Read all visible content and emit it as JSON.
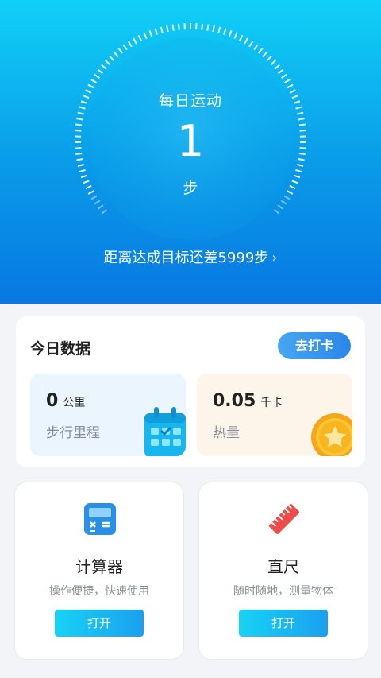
{
  "hero": {
    "title": "每日运动",
    "steps": "1",
    "unit": "步",
    "goal_text": "距离达成目标还差5999步"
  },
  "today": {
    "title": "今日数据",
    "checkin_label": "去打卡",
    "distance": {
      "value": "0",
      "unit": "公里",
      "label": "步行里程"
    },
    "calories": {
      "value": "0.05",
      "unit": "千卡",
      "label": "热量"
    }
  },
  "tools": [
    {
      "name": "计算器",
      "desc": "操作便捷，快速使用",
      "button": "打开",
      "icon": "calculator-icon"
    },
    {
      "name": "直尺",
      "desc": "随时随地，测量物体",
      "button": "打开",
      "icon": "ruler-icon"
    }
  ],
  "colors": {
    "hero_top": "#10d0f6",
    "hero_bottom": "#0878e2",
    "accent": "#2b86e8",
    "open_button": "#18d2f4"
  }
}
